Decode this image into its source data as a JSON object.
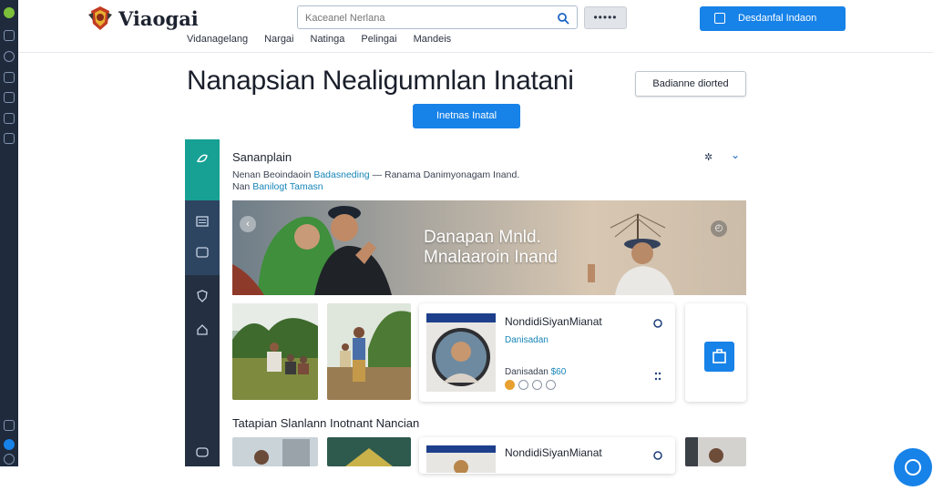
{
  "brand": {
    "name": "Viaogai"
  },
  "nav": {
    "items": [
      "Vidanagelang",
      "Nargai",
      "Natinga",
      "Pelingai",
      "Mandeis"
    ]
  },
  "search": {
    "placeholder": "Kaceanel Nerlana"
  },
  "header": {
    "more_label": "•••••",
    "cta_label": "Desdanfal Indaon"
  },
  "main": {
    "title": "Nanapsian Nealigumnlan Inatani",
    "install_label": "Inetnas Inatal",
    "right_button_label": "Badianne diorted"
  },
  "section": {
    "title": "Sananplain",
    "desc_prefix": "Nenan  Beoindaoin",
    "desc_link": "Badasneding",
    "desc_suffix": "— Ranama Danimyonagam Inand.",
    "desc_line2_prefix": "Nan",
    "desc_line2_link": "Banilogt Tamasn"
  },
  "hero": {
    "line1": "Danapan Mnld.",
    "line2": "Mnalaaroin Inand"
  },
  "cards": [
    {
      "title": "NondidiSiyanMianat",
      "subtitle": "Danisadan",
      "meta": "Danisadan",
      "price": "$60"
    },
    {
      "title": "NondidiSiyanMianat",
      "subtitle": "",
      "meta": "",
      "price": ""
    }
  ],
  "section2": {
    "title": "Tatapian Slanlann  Inotnant Nancian"
  },
  "colors": {
    "accent": "#1782e8",
    "teal": "#17a094",
    "sidebar": "#243041",
    "link": "#1785b8"
  }
}
